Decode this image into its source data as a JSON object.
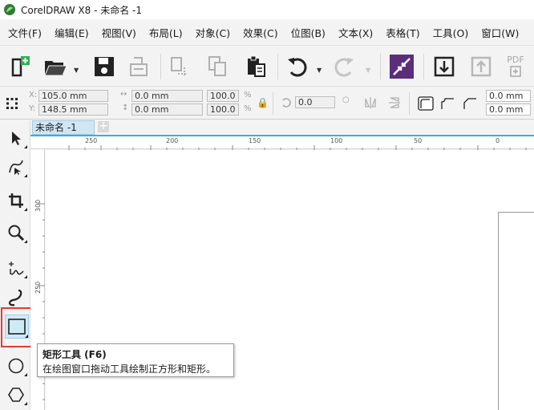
{
  "window": {
    "title": "CorelDRAW X8 - 未命名 -1"
  },
  "menu": [
    "文件(F)",
    "编辑(E)",
    "视图(V)",
    "布局(L)",
    "对象(C)",
    "效果(C)",
    "位图(B)",
    "文本(X)",
    "表格(T)",
    "工具(O)",
    "窗口(W)"
  ],
  "toolbar": {
    "items": [
      "new-document-icon",
      "open-icon",
      "save-icon",
      "print-icon",
      "cut-icon",
      "copy-icon",
      "paste-icon",
      "undo-icon",
      "redo-icon",
      "import-icon",
      "export-icon",
      "publish-pdf-icon"
    ],
    "pdf_label": "PDF"
  },
  "propbar": {
    "x_label": "X:",
    "x_value": "105.0 mm",
    "y_label": "Y:",
    "y_value": "148.5 mm",
    "w_value": "0.0 mm",
    "h_value": "0.0 mm",
    "scale_w": "100.0",
    "scale_h": "100.0",
    "percent": "%",
    "rotation": "0.0",
    "corner_1": "0.0 mm",
    "corner_2": "0.0 mm"
  },
  "document": {
    "tab_label": "未命名 -1",
    "add_tab": "+"
  },
  "ruler": {
    "horizontal": [
      "250",
      "200",
      "150",
      "100",
      "50",
      "0"
    ],
    "vertical": [
      "300",
      "250"
    ]
  },
  "tooltip": {
    "title": "矩形工具 (F6)",
    "description": "在绘图窗口拖动工具绘制正方形和矩形。"
  },
  "colors": {
    "accent": "#35b0d8",
    "highlight": "#e53935",
    "active_tool_bg": "#cfeaf7",
    "pdf_grey": "#a8a8a8"
  }
}
